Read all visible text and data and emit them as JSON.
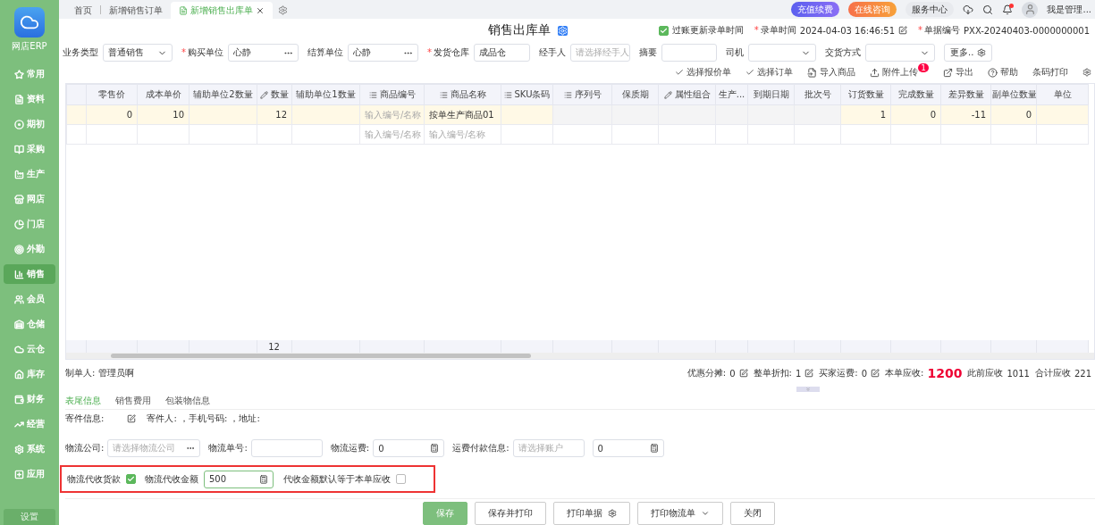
{
  "app": {
    "logo_label": "网店ERP"
  },
  "sidebar": {
    "items": [
      {
        "label": "常用",
        "selected": false
      },
      {
        "label": "资料",
        "selected": false
      },
      {
        "label": "期初",
        "selected": false
      },
      {
        "label": "采购",
        "selected": false
      },
      {
        "label": "生产",
        "selected": false
      },
      {
        "label": "网店",
        "selected": false
      },
      {
        "label": "门店",
        "selected": false
      },
      {
        "label": "外勤",
        "selected": false
      },
      {
        "label": "销售",
        "selected": true
      },
      {
        "label": "会员",
        "selected": false
      },
      {
        "label": "仓储",
        "selected": false
      },
      {
        "label": "云仓",
        "selected": false
      },
      {
        "label": "库存",
        "selected": false
      },
      {
        "label": "财务",
        "selected": false
      },
      {
        "label": "经营",
        "selected": false
      },
      {
        "label": "系统",
        "selected": false
      },
      {
        "label": "应用",
        "selected": false
      }
    ],
    "footer": "设置"
  },
  "tabs": [
    {
      "label": "首页",
      "selected": false,
      "closable": false
    },
    {
      "label": "新增销售订单",
      "selected": false,
      "closable": false
    },
    {
      "label": "新增销售出库单",
      "selected": true,
      "closable": true
    }
  ],
  "header": {
    "buttons": [
      {
        "label": "充值续费",
        "kind": "recharge"
      },
      {
        "label": "在线咨询",
        "kind": "consult"
      },
      {
        "label": "服务中心",
        "kind": "plain"
      }
    ],
    "unread": true,
    "user": "我是管理..."
  },
  "document": {
    "title": "销售出库单",
    "post_update": {
      "label": "过账更新录单时间",
      "checked": true
    },
    "record_time": {
      "label": "录单时间",
      "value": "2024-04-03 16:46:51",
      "required_mark": "*"
    },
    "doc_number": {
      "label": "单据编号",
      "value": "PXX-20240403-0000000001",
      "required_mark": "*"
    }
  },
  "form_fields": [
    {
      "label": "业务类型",
      "kind": "select",
      "value": "普通销售"
    },
    {
      "label": "购买单位",
      "required_mark": "*",
      "kind": "picker",
      "value": "心静"
    },
    {
      "label": "结算单位",
      "kind": "picker",
      "value": "心静"
    },
    {
      "label": "发货仓库",
      "required_mark": "*",
      "kind": "text",
      "value": "成品仓"
    },
    {
      "label": "经手人",
      "kind": "text",
      "placeholder": "请选择经手人"
    },
    {
      "label": "摘要",
      "kind": "text"
    },
    {
      "label": "司机",
      "kind": "select"
    },
    {
      "label": "交货方式",
      "kind": "select"
    }
  ],
  "more_button": "更多..",
  "toolbar": [
    {
      "label": "选择报价单",
      "kind": "check"
    },
    {
      "label": "选择订单",
      "kind": "check"
    },
    {
      "label": "导入商品",
      "kind": "import"
    },
    {
      "label": "附件上传",
      "kind": "upload",
      "badge": "1"
    },
    {
      "label": "导出",
      "kind": "export"
    },
    {
      "label": "帮助",
      "kind": "help"
    },
    {
      "label": "条码打印",
      "kind": "plain"
    }
  ],
  "table": {
    "columns": [
      {
        "kind": "index"
      },
      {
        "label": "零售价",
        "kind": "plain"
      },
      {
        "label": "成本单价",
        "kind": "plain"
      },
      {
        "label": "辅助单位2数量",
        "kind": "plain"
      },
      {
        "label": "数量",
        "kind": "editable",
        "total": "12"
      },
      {
        "label": "辅助单位1数量",
        "kind": "plain"
      },
      {
        "label": "商品编号",
        "kind": "lookup"
      },
      {
        "label": "商品名称",
        "kind": "lookup"
      },
      {
        "label": "SKU条码",
        "kind": "lookup"
      },
      {
        "label": "序列号",
        "kind": "lookup"
      },
      {
        "label": "保质期",
        "kind": "plain"
      },
      {
        "label": "属性组合",
        "kind": "editable"
      },
      {
        "label": "生产...",
        "kind": "plain"
      },
      {
        "label": "到期日期",
        "kind": "plain"
      },
      {
        "label": "批次号",
        "kind": "plain"
      },
      {
        "label": "订货数量",
        "kind": "plain"
      },
      {
        "label": "完成数量",
        "kind": "plain"
      },
      {
        "label": "差异数量",
        "kind": "plain"
      },
      {
        "label": "副单位数量",
        "kind": "plain"
      },
      {
        "label": "单位",
        "kind": "plain"
      }
    ],
    "rows": [
      {
        "selected": true,
        "cells": [
          {},
          {
            "text": "0",
            "kind": "number"
          },
          {
            "text": "10",
            "kind": "number"
          },
          {},
          {
            "text": "12",
            "kind": "number"
          },
          {},
          {
            "placeholder": "输入编号/名称"
          },
          {
            "text": "按单生产商品01",
            "kind": "text"
          },
          {},
          {
            "locked": true
          },
          {
            "locked": true
          },
          {
            "locked": true
          },
          {
            "locked": true
          },
          {
            "locked": true
          },
          {
            "locked": true
          },
          {
            "text": "1",
            "kind": "number"
          },
          {
            "text": "0",
            "kind": "number"
          },
          {
            "text": "-11",
            "kind": "number"
          },
          {
            "text": "0",
            "kind": "number"
          },
          {}
        ]
      },
      {
        "selected": false,
        "cells": [
          {},
          {},
          {},
          {},
          {},
          {},
          {
            "placeholder": "输入编号/名称"
          },
          {
            "placeholder": "输入编号/名称"
          },
          {},
          {},
          {},
          {},
          {},
          {},
          {},
          {},
          {},
          {},
          {},
          {}
        ]
      }
    ]
  },
  "maker": "制单人: 管理员啊",
  "summary": [
    {
      "label": "优惠分摊:",
      "value": "0",
      "kind": "editable"
    },
    {
      "label": "整单折扣:",
      "value": "1",
      "kind": "editable"
    },
    {
      "label": "买家运费:",
      "value": "0",
      "kind": "editable"
    },
    {
      "label": "本单应收:",
      "value": "1200",
      "kind": "emphasis"
    },
    {
      "label": "此前应收",
      "value": "1011",
      "kind": "plain"
    },
    {
      "label": "合计应收",
      "value": "221",
      "kind": "plain"
    }
  ],
  "footer_tabs": [
    {
      "label": "表尾信息",
      "selected": true
    },
    {
      "label": "销售费用",
      "selected": false
    },
    {
      "label": "包装物信息",
      "selected": false
    }
  ],
  "sender": {
    "label": "寄件信息:",
    "value": "寄件人: ，手机号码: ，地址:"
  },
  "logistics": [
    {
      "label": "物流公司:",
      "kind": "picker",
      "placeholder": "请选择物流公司"
    },
    {
      "label": "物流单号:",
      "kind": "text"
    },
    {
      "label": "物流运费:",
      "kind": "calc",
      "value": "0"
    },
    {
      "label": "运费付款信息:",
      "kind": "text",
      "placeholder": "请选择账户"
    },
    {
      "kind": "calc",
      "value": "0"
    }
  ],
  "cod": {
    "enabled": {
      "label": "物流代收货款",
      "checked": true
    },
    "amount": {
      "label": "物流代收金额",
      "value": "500"
    },
    "default_receivable": {
      "label": "代收金额默认等于本单应收",
      "checked": false
    }
  },
  "actions": [
    {
      "label": "保存",
      "kind": "primary"
    },
    {
      "label": "保存并打印",
      "kind": "plain"
    },
    {
      "label": "打印单据",
      "kind": "settings"
    },
    {
      "label": "打印物流单",
      "kind": "dropdown"
    },
    {
      "label": "关闭",
      "kind": "plain"
    }
  ]
}
